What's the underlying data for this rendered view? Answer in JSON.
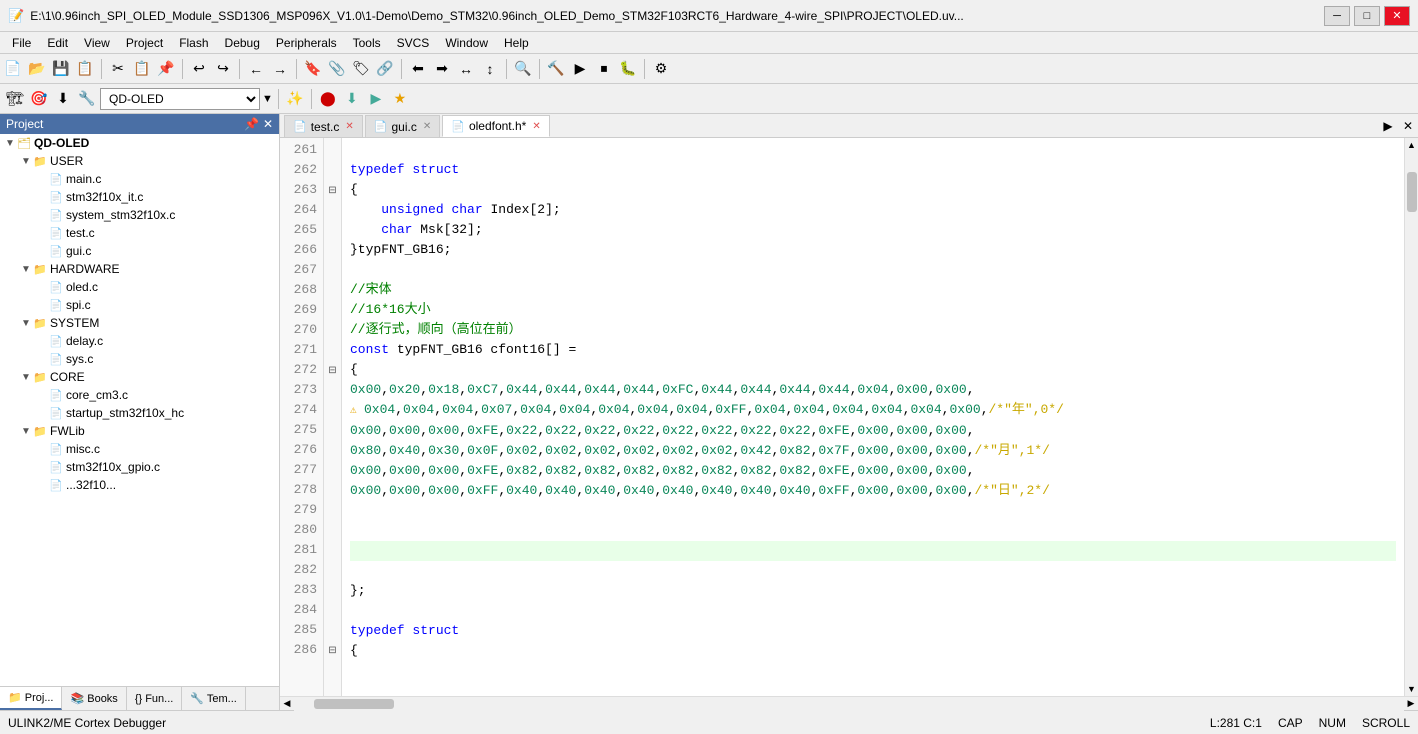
{
  "titleBar": {
    "title": "E:\\1\\0.96inch_SPI_OLED_Module_SSD1306_MSP096X_V1.0\\1-Demo\\Demo_STM32\\0.96inch_OLED_Demo_STM32F103RCT6_Hardware_4-wire_SPI\\PROJECT\\OLED.uv...",
    "minimizeLabel": "─",
    "maximizeLabel": "□",
    "closeLabel": "✕"
  },
  "menuBar": {
    "items": [
      "File",
      "Edit",
      "View",
      "Project",
      "Flash",
      "Debug",
      "Peripherals",
      "Tools",
      "SVCS",
      "Window",
      "Help"
    ]
  },
  "toolbar2": {
    "projectName": "QD-OLED",
    "dropdownArrow": "▼"
  },
  "projectPanel": {
    "title": "Project",
    "pinLabel": "📌",
    "closeLabel": "✕",
    "tree": [
      {
        "id": "qd-oled",
        "level": 0,
        "expanded": true,
        "type": "root",
        "label": "QD-OLED",
        "icon": "folder"
      },
      {
        "id": "user",
        "level": 1,
        "expanded": true,
        "type": "folder",
        "label": "USER",
        "icon": "folder"
      },
      {
        "id": "main-c",
        "level": 2,
        "expanded": false,
        "type": "file",
        "label": "main.c",
        "icon": "file"
      },
      {
        "id": "stm32f10x-it",
        "level": 2,
        "expanded": false,
        "type": "file",
        "label": "stm32f10x_it.c",
        "icon": "file"
      },
      {
        "id": "system-stm32",
        "level": 2,
        "expanded": false,
        "type": "file",
        "label": "system_stm32f10x.c",
        "icon": "file"
      },
      {
        "id": "test-c",
        "level": 2,
        "expanded": false,
        "type": "file",
        "label": "test.c",
        "icon": "file"
      },
      {
        "id": "gui-c",
        "level": 2,
        "expanded": false,
        "type": "file",
        "label": "gui.c",
        "icon": "file"
      },
      {
        "id": "hardware",
        "level": 1,
        "expanded": true,
        "type": "folder",
        "label": "HARDWARE",
        "icon": "folder"
      },
      {
        "id": "oled-c",
        "level": 2,
        "expanded": false,
        "type": "file",
        "label": "oled.c",
        "icon": "file"
      },
      {
        "id": "spi-c",
        "level": 2,
        "expanded": false,
        "type": "file",
        "label": "spi.c",
        "icon": "file"
      },
      {
        "id": "system",
        "level": 1,
        "expanded": true,
        "type": "folder",
        "label": "SYSTEM",
        "icon": "folder"
      },
      {
        "id": "delay-c",
        "level": 2,
        "expanded": false,
        "type": "file",
        "label": "delay.c",
        "icon": "file"
      },
      {
        "id": "sys-c",
        "level": 2,
        "expanded": false,
        "type": "file",
        "label": "sys.c",
        "icon": "file"
      },
      {
        "id": "core",
        "level": 1,
        "expanded": true,
        "type": "folder",
        "label": "CORE",
        "icon": "folder"
      },
      {
        "id": "core-cm3",
        "level": 2,
        "expanded": false,
        "type": "file",
        "label": "core_cm3.c",
        "icon": "file"
      },
      {
        "id": "startup",
        "level": 2,
        "expanded": false,
        "type": "file",
        "label": "startup_stm32f10x_hc",
        "icon": "file"
      },
      {
        "id": "fwlib",
        "level": 1,
        "expanded": true,
        "type": "folder",
        "label": "FWLib",
        "icon": "folder"
      },
      {
        "id": "misc-c",
        "level": 2,
        "expanded": false,
        "type": "file",
        "label": "misc.c",
        "icon": "file"
      },
      {
        "id": "stm32f10x-gpio",
        "level": 2,
        "expanded": false,
        "type": "file",
        "label": "stm32f10x_gpio.c",
        "icon": "file"
      },
      {
        "id": "more",
        "level": 2,
        "expanded": false,
        "type": "file",
        "label": "...32f10...",
        "icon": "file"
      }
    ],
    "tabs": [
      {
        "id": "project",
        "label": "📁 Proj...",
        "active": true
      },
      {
        "id": "books",
        "label": "📚 Books"
      },
      {
        "id": "functions",
        "label": "{} Fun..."
      },
      {
        "id": "templates",
        "label": "🔧 Tem..."
      }
    ]
  },
  "editorTabs": [
    {
      "id": "test-c",
      "label": "test.c",
      "active": false,
      "modified": true,
      "icon": "📄"
    },
    {
      "id": "gui-c",
      "label": "gui.c",
      "active": false,
      "modified": false,
      "icon": "📄"
    },
    {
      "id": "oledfont-h",
      "label": "oledfont.h*",
      "active": true,
      "modified": true,
      "icon": "📄"
    }
  ],
  "codeLines": [
    {
      "num": 261,
      "content": "",
      "highlight": false
    },
    {
      "num": 262,
      "content": "typedef struct",
      "highlight": false
    },
    {
      "num": 263,
      "content": "{",
      "foldable": true,
      "highlight": false
    },
    {
      "num": 264,
      "content": "    unsigned char Index[2];",
      "highlight": false
    },
    {
      "num": 265,
      "content": "    char Msk[32];",
      "highlight": false
    },
    {
      "num": 266,
      "content": "}typFNT_GB16;",
      "highlight": false
    },
    {
      "num": 267,
      "content": "",
      "highlight": false
    },
    {
      "num": 268,
      "content": "//宋体",
      "highlight": false
    },
    {
      "num": 269,
      "content": "//16*16大小",
      "highlight": false
    },
    {
      "num": 270,
      "content": "//逐行式，顺向（高位在前）",
      "highlight": false
    },
    {
      "num": 271,
      "content": "const typFNT_GB16 cfont16[] =",
      "highlight": false
    },
    {
      "num": 272,
      "content": "{",
      "foldable": true,
      "highlight": false
    },
    {
      "num": 273,
      "content": "0x00,0x20,0x18,0xC7,0x44,0x44,0x44,0x44,0xFC,0x44,0x44,0x44,0x44,0x04,0x00,0x00,",
      "highlight": false,
      "warning": false
    },
    {
      "num": 274,
      "content": "0x04,0x04,0x04,0x07,0x04,0x04,0x04,0x04,0x04,0xFF,0x04,0x04,0x04,0x04,0x04,0x00,/*\"年\",0*/",
      "highlight": false,
      "warning": true
    },
    {
      "num": 275,
      "content": "0x00,0x00,0x00,0xFE,0x22,0x22,0x22,0x22,0x22,0x22,0x22,0x22,0xFE,0x00,0x00,0x00,",
      "highlight": false
    },
    {
      "num": 276,
      "content": "0x80,0x40,0x30,0x0F,0x02,0x02,0x02,0x02,0x02,0x02,0x42,0x82,0x7F,0x00,0x00,0x00,/*\"月\",1*/",
      "highlight": false
    },
    {
      "num": 277,
      "content": "0x00,0x00,0x00,0xFE,0x82,0x82,0x82,0x82,0x82,0x82,0x82,0x82,0xFE,0x00,0x00,0x00,",
      "highlight": false
    },
    {
      "num": 278,
      "content": "0x00,0x00,0x00,0xFF,0x40,0x40,0x40,0x40,0x40,0x40,0x40,0x40,0xFF,0x00,0x00,0x00,/*\"日\",2*/",
      "highlight": false
    },
    {
      "num": 279,
      "content": "",
      "highlight": false
    },
    {
      "num": 280,
      "content": "",
      "highlight": false
    },
    {
      "num": 281,
      "content": "",
      "highlight": true,
      "active": true
    },
    {
      "num": 282,
      "content": "",
      "highlight": false
    },
    {
      "num": 283,
      "content": "};",
      "highlight": false
    },
    {
      "num": 284,
      "content": "",
      "highlight": false
    },
    {
      "num": 285,
      "content": "typedef struct",
      "highlight": false
    },
    {
      "num": 286,
      "content": "{",
      "foldable": true,
      "highlight": false
    }
  ],
  "statusBar": {
    "debugger": "ULINK2/ME Cortex Debugger",
    "position": "L:281 C:1",
    "capsLock": "CAP",
    "numLock": "NUM",
    "scroll": "SCROLL"
  }
}
